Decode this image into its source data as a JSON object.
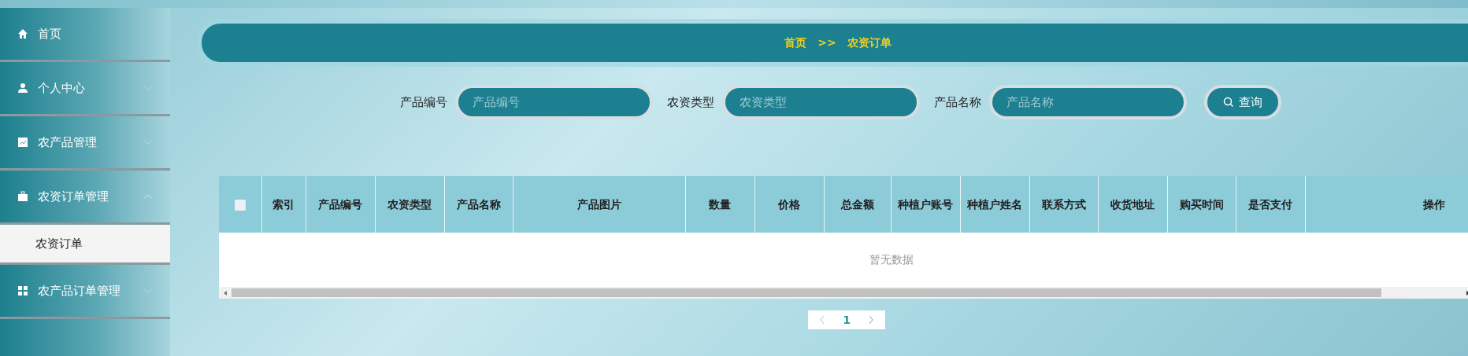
{
  "sidebar": {
    "items": [
      {
        "label": "首页",
        "kind": "home"
      },
      {
        "label": "个人中心",
        "kind": "user",
        "expanded": false
      },
      {
        "label": "农产品管理",
        "kind": "chart",
        "expanded": false
      },
      {
        "label": "农资订单管理",
        "kind": "briefcase",
        "expanded": true,
        "children": [
          {
            "label": "农资订单",
            "selected": true
          }
        ]
      },
      {
        "label": "农产品订单管理",
        "kind": "grid",
        "expanded": false
      }
    ]
  },
  "breadcrumb": [
    "首页",
    ">>",
    "农资订单"
  ],
  "search": {
    "fields": [
      {
        "label": "产品编号",
        "placeholder": "产品编号"
      },
      {
        "label": "农资类型",
        "placeholder": "农资类型"
      },
      {
        "label": "产品名称",
        "placeholder": "产品名称"
      }
    ],
    "button": "查询"
  },
  "table": {
    "select_all_checked": false,
    "columns": [
      "索引",
      "产品编号",
      "农资类型",
      "产品名称",
      "产品图片",
      "数量",
      "价格",
      "总金额",
      "种植户账号",
      "种植户姓名",
      "联系方式",
      "收货地址",
      "购买时间",
      "是否支付",
      "操作"
    ],
    "empty_text": "暂无数据"
  },
  "pagination": {
    "pages": [
      {
        "label": "1",
        "selected": true
      }
    ]
  }
}
